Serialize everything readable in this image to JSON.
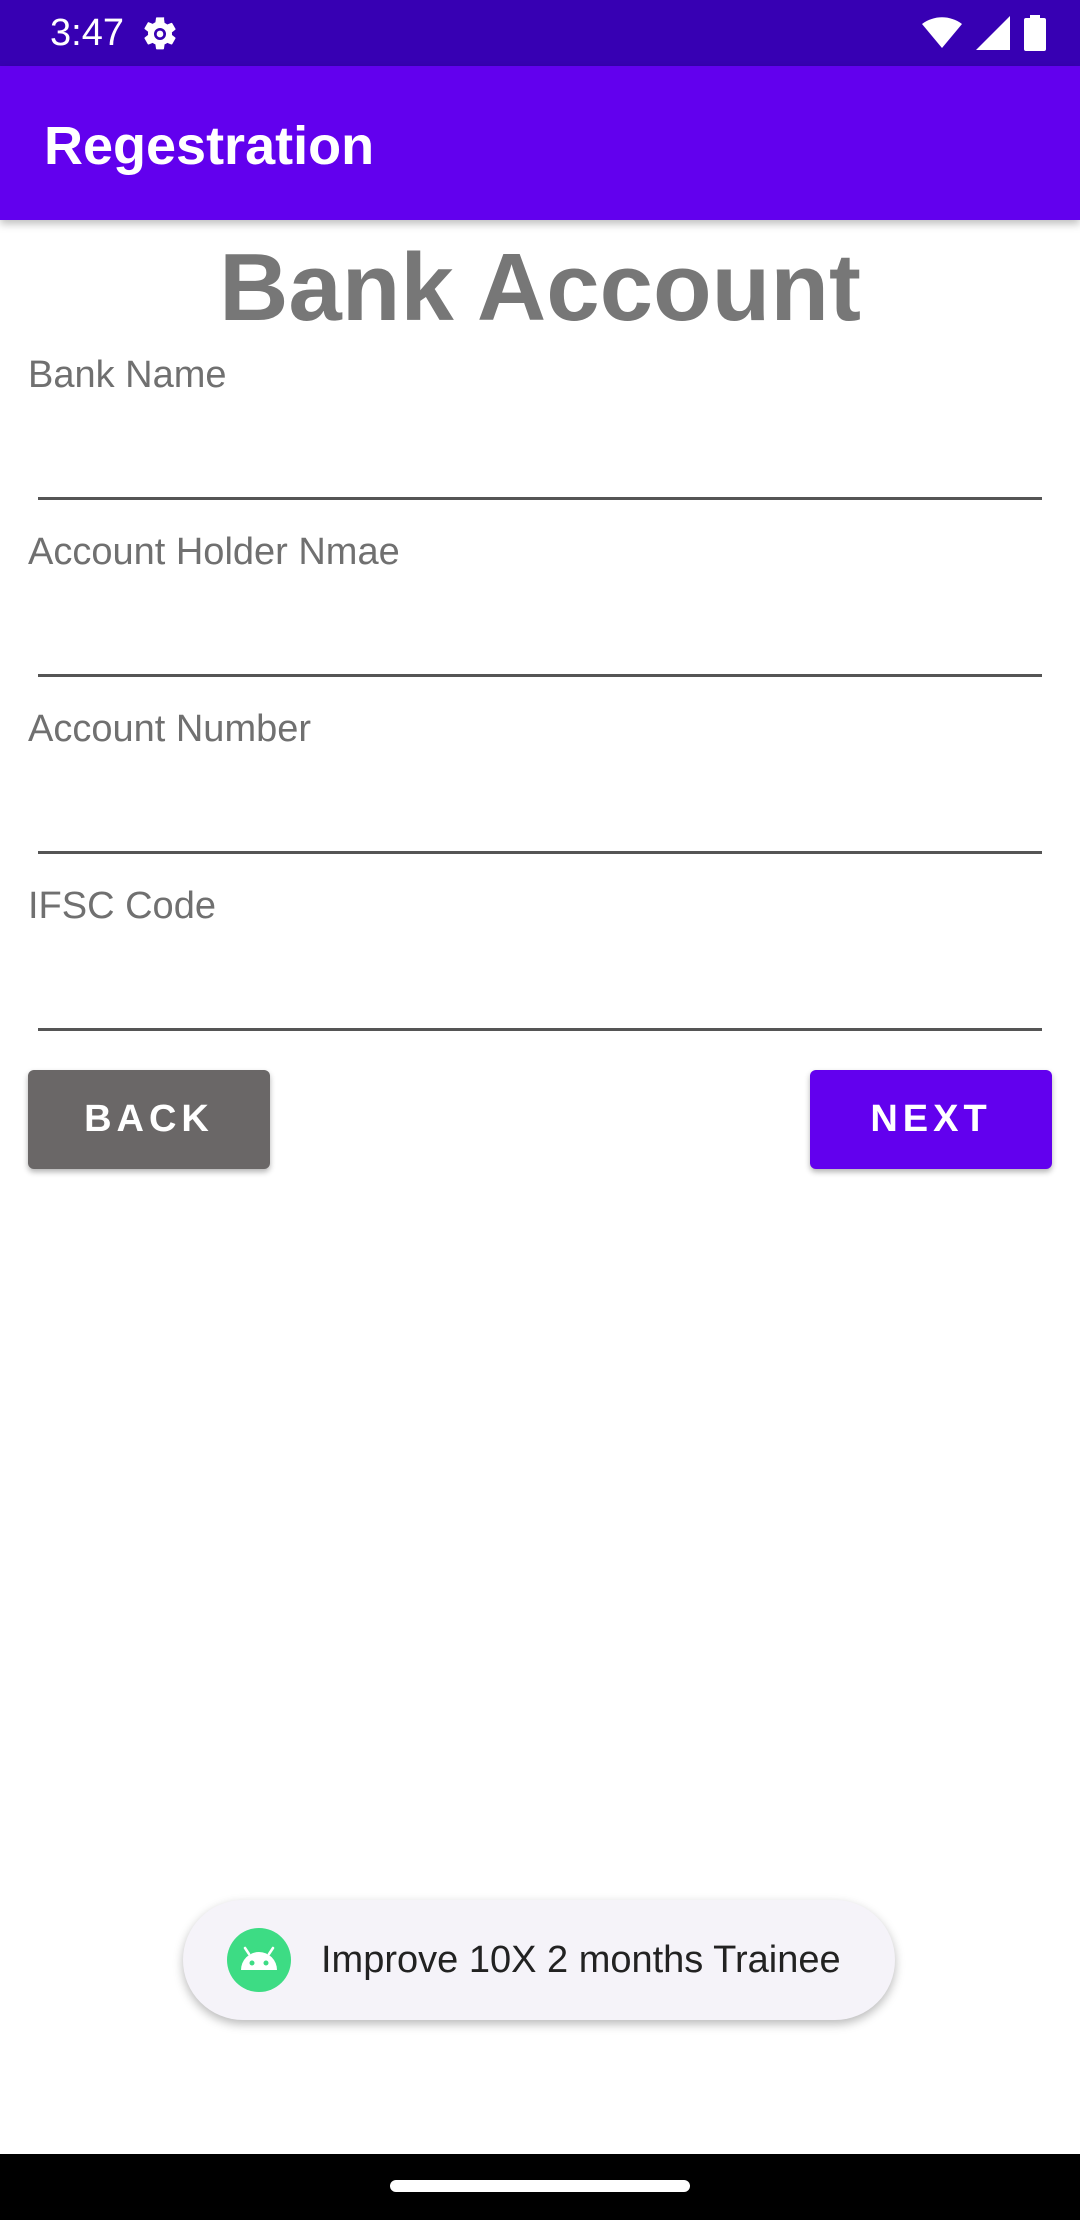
{
  "status_bar": {
    "time": "3:47",
    "icons": [
      "settings-icon",
      "wifi-icon",
      "signal-icon",
      "battery-icon"
    ]
  },
  "app_bar": {
    "title": "Regestration",
    "color": "#6200ee"
  },
  "page": {
    "heading": "Bank Account"
  },
  "form": {
    "fields": [
      {
        "label": "Bank Name",
        "value": ""
      },
      {
        "label": "Account Holder Nmae",
        "value": ""
      },
      {
        "label": "Account Number",
        "value": ""
      },
      {
        "label": "IFSC Code",
        "value": ""
      }
    ]
  },
  "buttons": {
    "back_label": "BACK",
    "next_label": "NEXT"
  },
  "toast": {
    "icon": "android-icon",
    "message": "Improve 10X 2 months Trainee"
  },
  "colors": {
    "status_bar": "#3700b3",
    "accent": "#6200ee",
    "back_button": "#6a6767"
  }
}
